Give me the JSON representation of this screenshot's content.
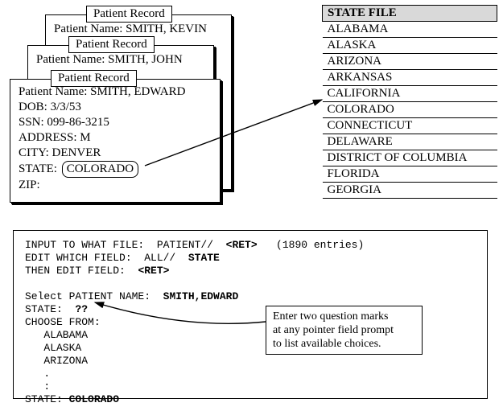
{
  "cards": {
    "tab_label": "Patient Record",
    "back_name": "Patient Name: SMITH, KEVIN",
    "mid_name": "Patient Name: SMITH, JOHN",
    "front": {
      "line_name": "Patient Name: SMITH, EDWARD",
      "line_dob": "DOB: 3/3/53",
      "line_ssn": "SSN: 099-86-3215",
      "line_addr": "ADDRESS: M",
      "line_city": "CITY: DENVER",
      "state_label": "STATE:",
      "state_value": "COLORADO",
      "line_zip": "ZIP:"
    }
  },
  "state_file": {
    "header": "STATE FILE",
    "rows": [
      "ALABAMA",
      "ALASKA",
      "ARIZONA",
      "ARKANSAS",
      "CALIFORNIA",
      "COLORADO",
      "CONNECTICUT",
      "DELAWARE",
      "DISTRICT OF COLUMBIA",
      "FLORIDA",
      "GEORGIA"
    ]
  },
  "terminal": {
    "l1a": "INPUT TO WHAT FILE:  PATIENT//  ",
    "l1_ret": "<RET>",
    "l1b": "   (1890 entries)",
    "l2a": "EDIT WHICH FIELD:  ALL//  ",
    "l2b": "STATE",
    "l3a": "THEN EDIT FIELD:  ",
    "l3_ret": "<RET>",
    "l4a": "Select PATIENT NAME:  ",
    "l4b": "SMITH,EDWARD",
    "l5a": "STATE:  ",
    "l5b": "??",
    "l6": "CHOOSE FROM:",
    "l7": "   ALABAMA",
    "l8": "   ALASKA",
    "l9": "   ARIZONA",
    "l10": "   .",
    "l11": "   :",
    "l12a": "STATE: ",
    "l12b": "COLORADO"
  },
  "callout": {
    "line1": "Enter two question marks",
    "line2": "at any pointer field prompt",
    "line3": "to list available choices."
  }
}
